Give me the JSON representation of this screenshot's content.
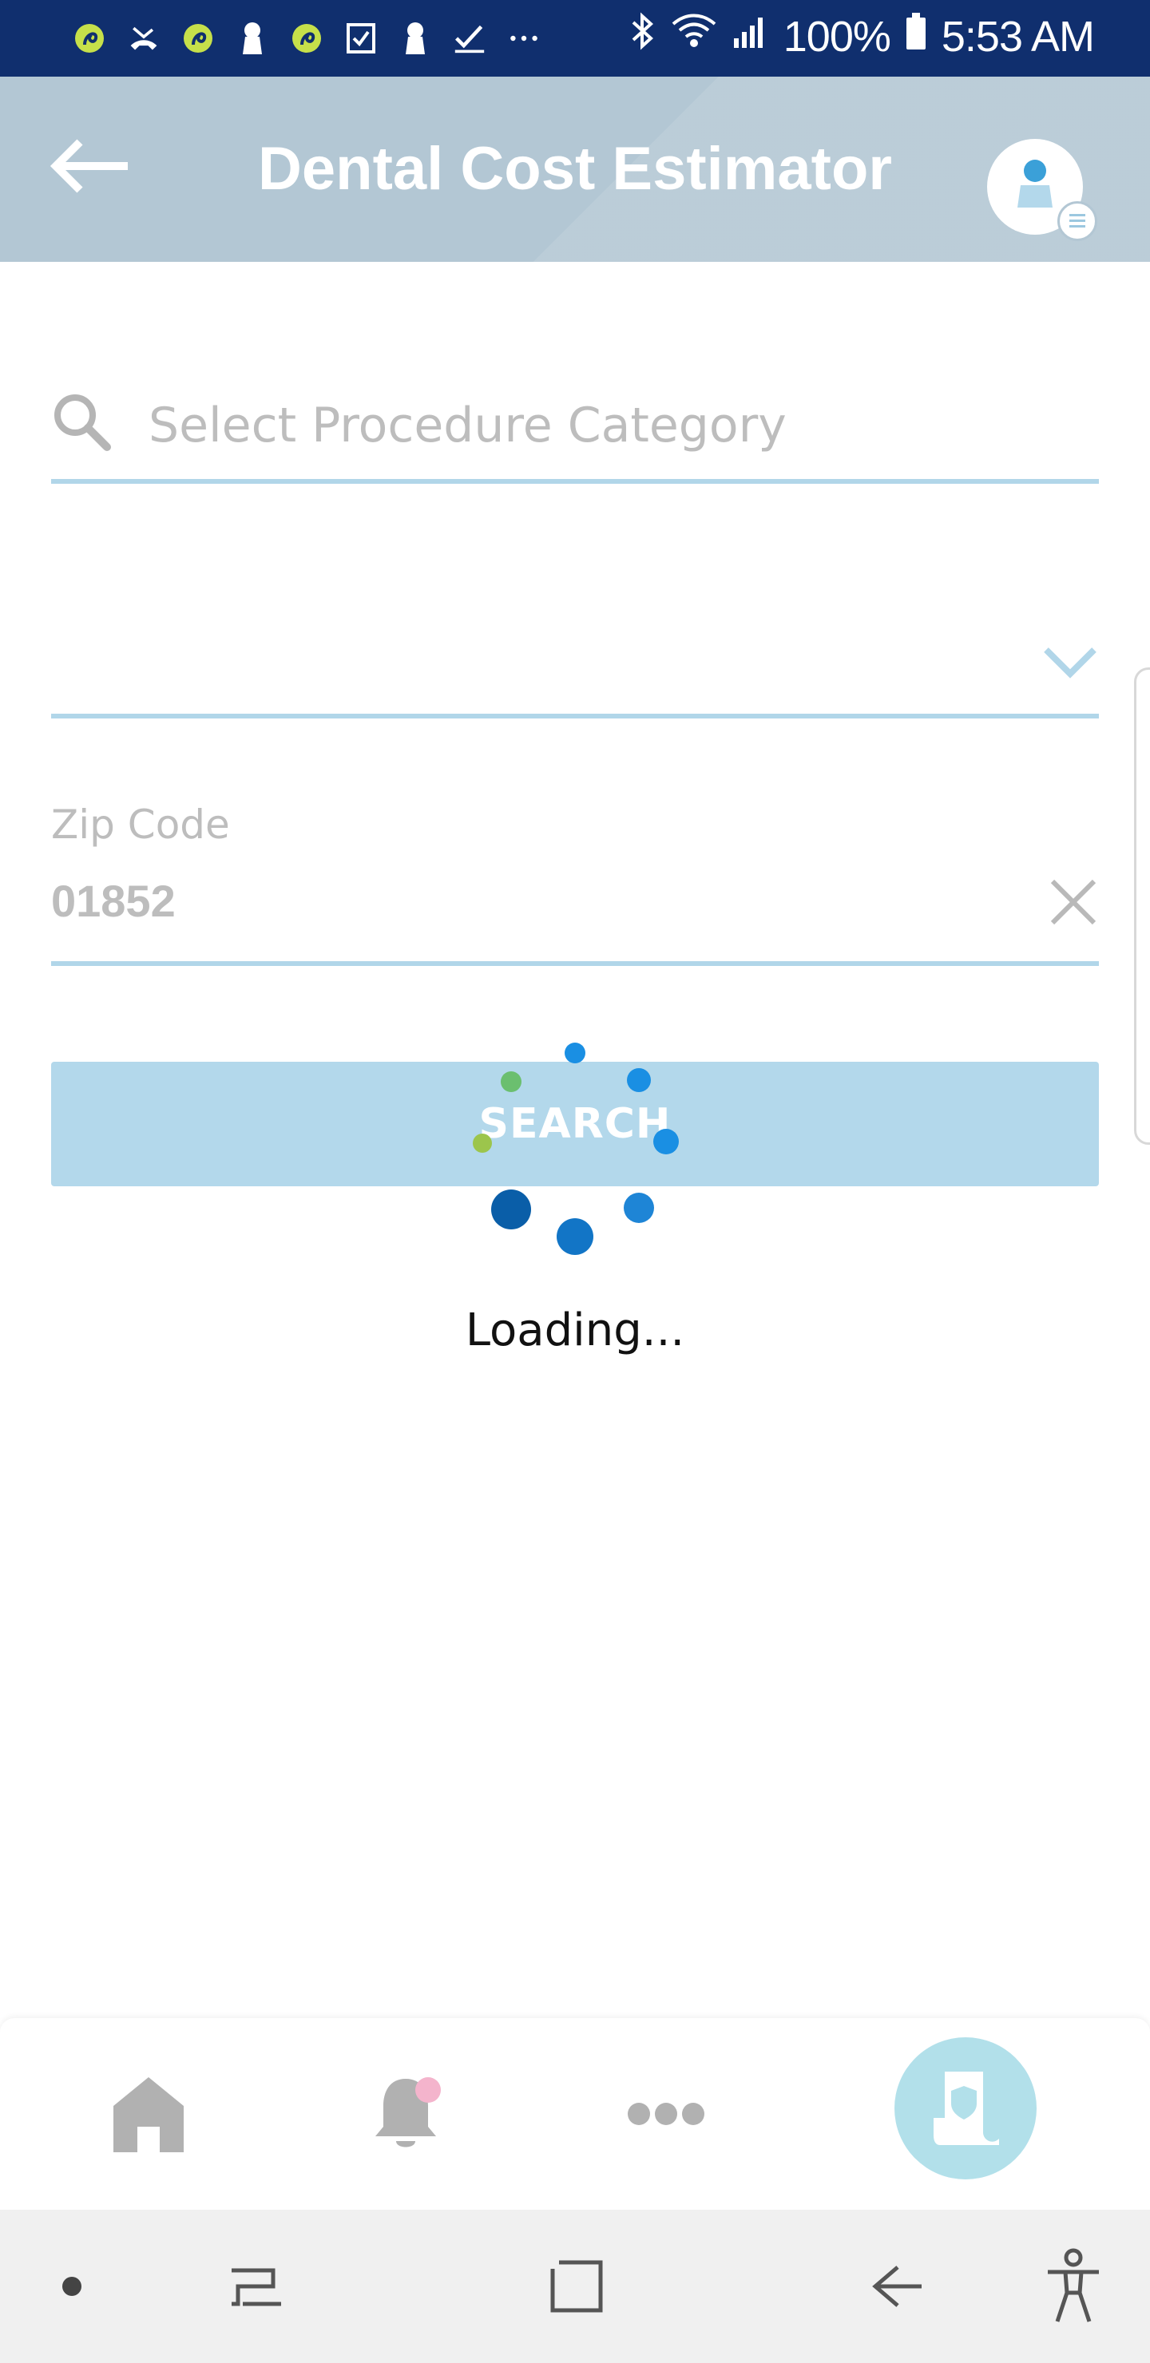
{
  "status_bar": {
    "battery": "100%",
    "time": "5:53 AM",
    "icons": [
      "app-icon",
      "missed-call-icon",
      "app-icon",
      "keyhole-icon",
      "app-icon",
      "checkbox-icon",
      "keyhole-icon",
      "check-icon",
      "more-dots-icon",
      "bluetooth-icon",
      "wifi-icon",
      "signal-icon",
      "battery-icon"
    ]
  },
  "header": {
    "title": "Dental Cost Estimator"
  },
  "form": {
    "search_placeholder": "Select Procedure Category",
    "zip_label": "Zip Code",
    "zip_value": "01852",
    "search_button": "SEARCH"
  },
  "loading": {
    "text": "Loading..."
  },
  "colors": {
    "status_bar": "#102f6e",
    "header": "#b3c7d4",
    "underline": "#b1d6e9",
    "button": "#b3d8eb",
    "fab": "#b2e0ea",
    "spinner_blue": "#1a8fe3",
    "spinner_dark": "#0a5ea8",
    "spinner_green": "#6bbf6f",
    "notification": "#f4b4cc"
  },
  "bottom_nav": {
    "items": [
      "home-icon",
      "bell-icon",
      "more-icon",
      "id-card-shield-icon"
    ]
  },
  "system_nav": {
    "items": [
      "dot",
      "recents",
      "home",
      "back",
      "accessibility"
    ]
  }
}
